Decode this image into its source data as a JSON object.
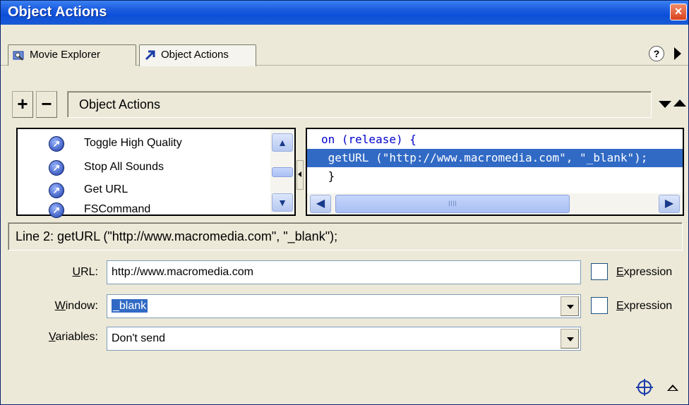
{
  "window": {
    "title": "Object Actions",
    "close_symbol": "×"
  },
  "tabs": [
    {
      "label": "Movie Explorer",
      "icon": "movie-explorer-icon",
      "active": false
    },
    {
      "label": "Object Actions",
      "icon": "object-actions-icon",
      "active": true
    }
  ],
  "toolbar": {
    "add_label": "+",
    "remove_label": "−",
    "path": "Object Actions",
    "help_label": "?"
  },
  "action_list": [
    {
      "label": "Toggle High Quality",
      "icon": "action-icon"
    },
    {
      "label": "Stop All Sounds",
      "icon": "action-icon"
    },
    {
      "label": "Get URL",
      "icon": "action-icon"
    },
    {
      "label": "FSCommand",
      "icon": "action-icon"
    }
  ],
  "code": {
    "lines": [
      {
        "text": "on (release) {",
        "selected": false
      },
      {
        "text": " getURL (\"http://www.macromedia.com\", \"_blank\");",
        "selected": true
      },
      {
        "text": " }",
        "selected": false
      }
    ],
    "scroll_thumb_marks": "IIII"
  },
  "status": {
    "text": "Line 2: getURL (\"http://www.macromedia.com\", \"_blank\");"
  },
  "form": {
    "url": {
      "label_prefix": "",
      "label_underline": "U",
      "label_rest": "RL:",
      "value": "http://www.macromedia.com",
      "expression_label_u": "E",
      "expression_label_rest": "xpression",
      "expression_checked": false
    },
    "window": {
      "label_underline": "W",
      "label_rest": "indow:",
      "value": "_blank",
      "expression_label_u": "E",
      "expression_label_rest": "xpression",
      "expression_checked": false
    },
    "variables": {
      "label_underline": "V",
      "label_rest": "ariables:",
      "value": "Don't send"
    }
  },
  "colors": {
    "title_bar": "#0c4fd8",
    "selection": "#316ac5",
    "keyword": "#0000cc",
    "panel_bg": "#ece9d8"
  }
}
